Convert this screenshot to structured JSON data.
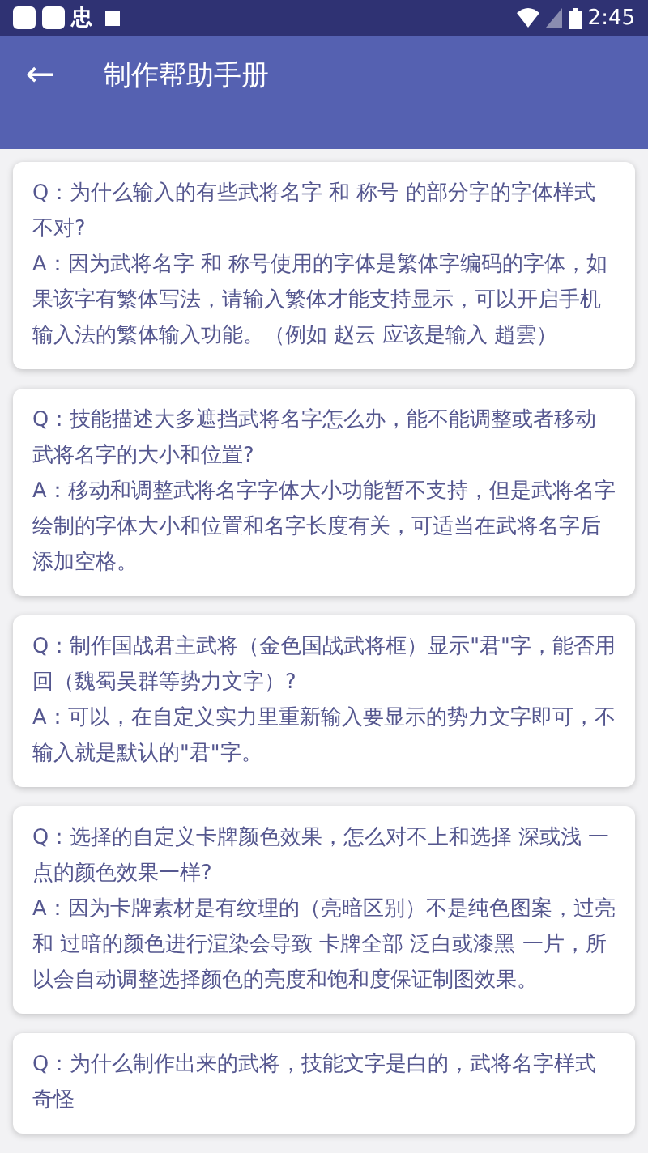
{
  "status_bar": {
    "time": "2:45",
    "notification_glyph": "忠"
  },
  "app_bar": {
    "back_glyph": "←",
    "title": "制作帮助手册"
  },
  "faqs": [
    {
      "question": "Q：为什么输入的有些武将名字 和 称号 的部分字的字体样式不对?",
      "answer": "A：因为武将名字 和 称号使用的字体是繁体字编码的字体，如果该字有繁体写法，请输入繁体才能支持显示，可以开启手机输入法的繁体输入功能。（例如 赵云 应该是输入 趙雲）"
    },
    {
      "question": "Q：技能描述大多遮挡武将名字怎么办，能不能调整或者移动武将名字的大小和位置?",
      "answer": "A：移动和调整武将名字字体大小功能暂不支持，但是武将名字绘制的字体大小和位置和名字长度有关，可适当在武将名字后添加空格。"
    },
    {
      "question": "Q：制作国战君主武将（金色国战武将框）显示\"君\"字，能否用回（魏蜀吴群等势力文字）?",
      "answer": "A：可以，在自定义实力里重新输入要显示的势力文字即可，不输入就是默认的\"君\"字。"
    },
    {
      "question": "Q：选择的自定义卡牌颜色效果，怎么对不上和选择 深或浅 一点的颜色效果一样?",
      "answer": "A：因为卡牌素材是有纹理的（亮暗区别）不是纯色图案，过亮和 过暗的颜色进行渲染会导致 卡牌全部 泛白或漆黑 一片，所以会自动调整选择颜色的亮度和饱和度保证制图效果。"
    },
    {
      "question": "Q：为什么制作出来的武将，技能文字是白的，武将名字样式奇怪"
    }
  ]
}
